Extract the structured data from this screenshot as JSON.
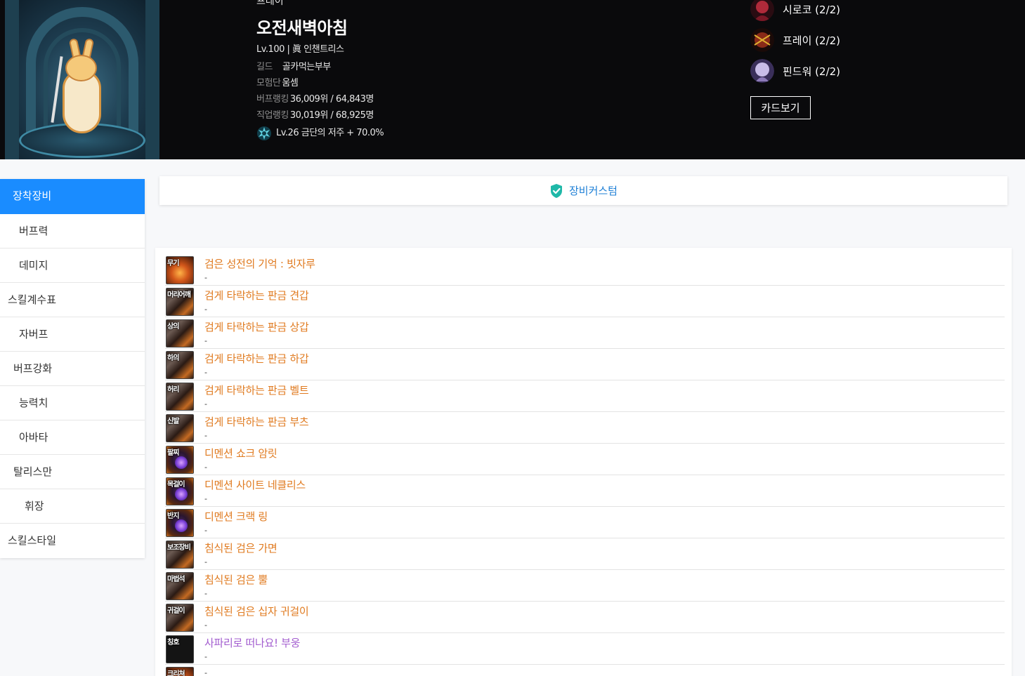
{
  "character": {
    "class": "프레이",
    "name": "오전새벽아침",
    "level_line": "Lv.100 | 眞 인챈트리스",
    "guild_label": "길드",
    "guild": "골카먹는부부",
    "adventure_label": "모험단",
    "adventure": "움셈",
    "buff_rank_label": "버프랭킹",
    "buff_rank": "36,009위 / 64,843명",
    "job_rank_label": "직업랭킹",
    "job_rank": "30,019위 / 68,925명",
    "curse": "Lv.26 금단의 저주 + 70.0%"
  },
  "party": [
    {
      "name": "시로코 (2/2)",
      "icon": "siroco-avatar",
      "color": "#8a1a2a"
    },
    {
      "name": "프레이 (2/2)",
      "icon": "prey-avatar",
      "color": "#6a1a12"
    },
    {
      "name": "핀드워 (2/2)",
      "icon": "fiendwar-avatar",
      "color": "#8d7ab8"
    }
  ],
  "card_button": "카드보기",
  "sidebar": {
    "items": [
      {
        "label": "장착장비",
        "active": true,
        "indent": 18
      },
      {
        "label": "버프력",
        "active": false,
        "indent": 27
      },
      {
        "label": "데미지",
        "active": false,
        "indent": 27
      },
      {
        "label": "스킬계수표",
        "active": false,
        "indent": 11
      },
      {
        "label": "자버프",
        "active": false,
        "indent": 27
      },
      {
        "label": "버프강화",
        "active": false,
        "indent": 19
      },
      {
        "label": "능력치",
        "active": false,
        "indent": 27
      },
      {
        "label": "아바타",
        "active": false,
        "indent": 27
      },
      {
        "label": "탈리스만",
        "active": false,
        "indent": 19
      },
      {
        "label": "휘장",
        "active": false,
        "indent": 35
      },
      {
        "label": "스킬스타일",
        "active": false,
        "indent": 11
      }
    ]
  },
  "custom_bar": {
    "label": "장비커스텀",
    "icon": "shield-check-icon",
    "color": "#1fb8a8"
  },
  "equipment": [
    {
      "slot": "무기",
      "name": "검은 성전의 기억 : 빗자루",
      "sub": "-",
      "rarity": "orange",
      "icon_style": "fire"
    },
    {
      "slot": "머리어깨",
      "name": "검게 타락하는 판금 견갑",
      "sub": "-",
      "rarity": "orange",
      "icon_style": "armor"
    },
    {
      "slot": "상의",
      "name": "검게 타락하는 판금 상갑",
      "sub": "-",
      "rarity": "orange",
      "icon_style": "armor"
    },
    {
      "slot": "하의",
      "name": "검게 타락하는 판금 하갑",
      "sub": "-",
      "rarity": "orange",
      "icon_style": "armor"
    },
    {
      "slot": "허리",
      "name": "검게 타락하는 판금 벨트",
      "sub": "-",
      "rarity": "orange",
      "icon_style": "armor"
    },
    {
      "slot": "신발",
      "name": "검게 타락하는 판금 부츠",
      "sub": "-",
      "rarity": "orange",
      "icon_style": "armor"
    },
    {
      "slot": "팔찌",
      "name": "디멘션 쇼크 암릿",
      "sub": "-",
      "rarity": "orange",
      "icon_style": "gem"
    },
    {
      "slot": "목걸이",
      "name": "디멘션 사이트 네클리스",
      "sub": "-",
      "rarity": "orange",
      "icon_style": "gem"
    },
    {
      "slot": "반지",
      "name": "디멘션 크랙 링",
      "sub": "-",
      "rarity": "orange",
      "icon_style": "gem"
    },
    {
      "slot": "보조장비",
      "name": "침식된 검은 가면",
      "sub": "-",
      "rarity": "orange",
      "icon_style": "armor"
    },
    {
      "slot": "마법석",
      "name": "침식된 검은 뿔",
      "sub": "-",
      "rarity": "orange",
      "icon_style": "armor"
    },
    {
      "slot": "귀걸이",
      "name": "침식된 검은 십자 귀걸이",
      "sub": "-",
      "rarity": "orange",
      "icon_style": "armor"
    },
    {
      "slot": "칭호",
      "name": "사파리로 떠나요! 부웅",
      "sub": "-",
      "rarity": "purple",
      "icon_style": "dark"
    },
    {
      "slot": "크리쳐",
      "name": "",
      "sub": "-",
      "rarity": "orange",
      "icon_style": "fire"
    }
  ]
}
